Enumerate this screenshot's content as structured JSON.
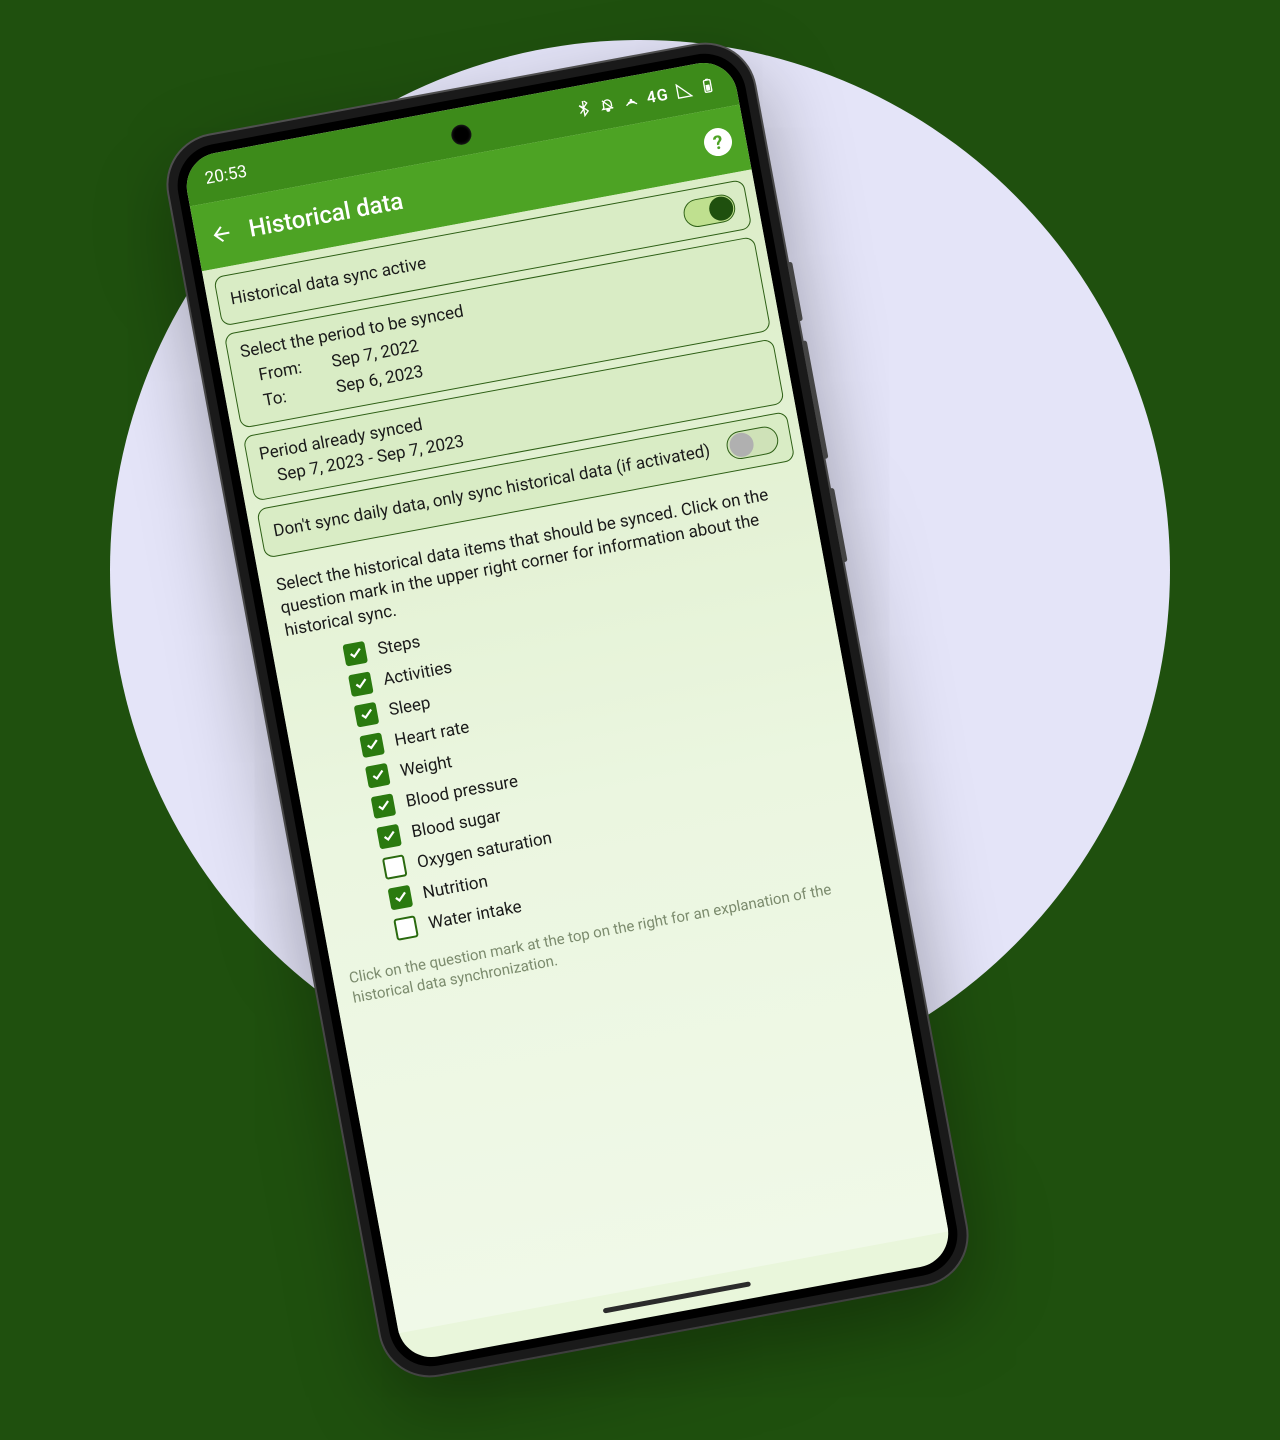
{
  "status": {
    "time": "20:53",
    "network": "4G"
  },
  "appbar": {
    "title": "Historical data"
  },
  "sync_active": {
    "label": "Historical data sync active",
    "on": true
  },
  "period": {
    "title": "Select the period to be synced",
    "from_label": "From:",
    "from_value": "Sep 7, 2022",
    "to_label": "To:",
    "to_value": "Sep 6, 2023"
  },
  "already": {
    "title": "Period already synced",
    "value": "Sep 7, 2023 - Sep 7, 2023"
  },
  "only_hist": {
    "label": "Don't sync daily data, only sync historical data (if activated)",
    "on": false
  },
  "instructions": "Select the historical data items that should be synced. Click on the question mark in the upper right corner for information about the historical sync.",
  "items": [
    {
      "label": "Steps",
      "checked": true
    },
    {
      "label": "Activities",
      "checked": true
    },
    {
      "label": "Sleep",
      "checked": true
    },
    {
      "label": "Heart rate",
      "checked": true
    },
    {
      "label": "Weight",
      "checked": true
    },
    {
      "label": "Blood pressure",
      "checked": true
    },
    {
      "label": "Blood sugar",
      "checked": true
    },
    {
      "label": "Oxygen saturation",
      "checked": false
    },
    {
      "label": "Nutrition",
      "checked": true
    },
    {
      "label": "Water intake",
      "checked": false
    }
  ],
  "footnote": "Click on the question mark at the top on the right for an explanation of the historical data synchronization."
}
